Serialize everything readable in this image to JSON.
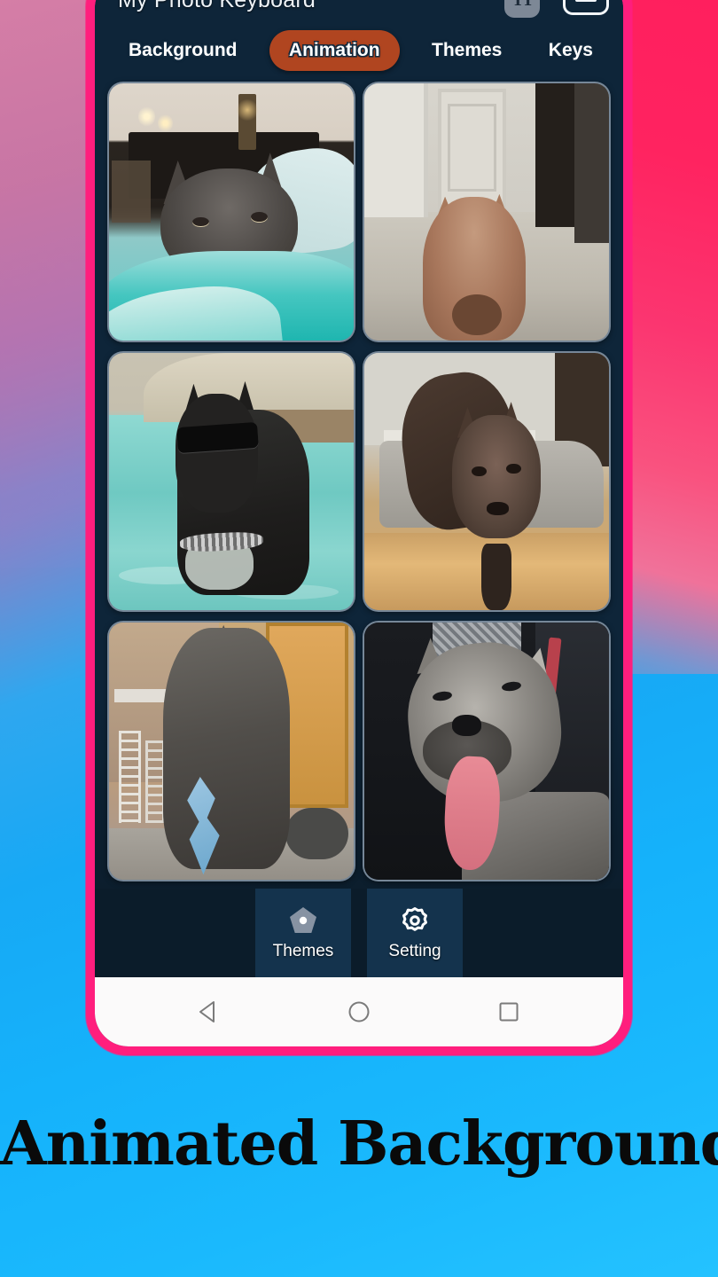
{
  "app": {
    "title": "My Photo Keyboard",
    "title_actions": [
      {
        "name": "text-style-button",
        "glyph": "TT"
      },
      {
        "name": "minimize-keyboard-button",
        "glyph": "—"
      }
    ],
    "accent_active_tab": "#b04520",
    "background_color": "#0e2539",
    "nav_selected_color": "#14334d"
  },
  "tabs": [
    {
      "label": "Background",
      "active": false
    },
    {
      "label": "Animation",
      "active": true
    },
    {
      "label": "Themes",
      "active": false
    },
    {
      "label": "Keys",
      "active": false
    }
  ],
  "grid": {
    "items": [
      {
        "alt": "Gray pitbull resting on teal towel in bedroom"
      },
      {
        "alt": "Fawn pitbull sitting in bright hallway with white doors"
      },
      {
        "alt": "Black pitbull wearing sunglasses standing in swimming pool"
      },
      {
        "alt": "Dark brown pitbull standing on wood floor beside gray rug"
      },
      {
        "alt": "Gray pitbull with blue chew toy near ladders"
      },
      {
        "alt": "Smiling gray pitbull with tongue out inside a car"
      }
    ]
  },
  "bottom_nav": [
    {
      "label": "Themes",
      "icon": "pentagon-home-icon",
      "selected": true
    },
    {
      "label": "Setting",
      "icon": "gear-icon",
      "selected": true
    }
  ],
  "android_nav": [
    {
      "name": "back-button",
      "icon": "triangle-back-icon"
    },
    {
      "name": "home-button",
      "icon": "circle-home-icon"
    },
    {
      "name": "recents-button",
      "icon": "square-recents-icon"
    }
  ],
  "caption": {
    "text": "Animated Background",
    "color": "#0a0a0a"
  }
}
